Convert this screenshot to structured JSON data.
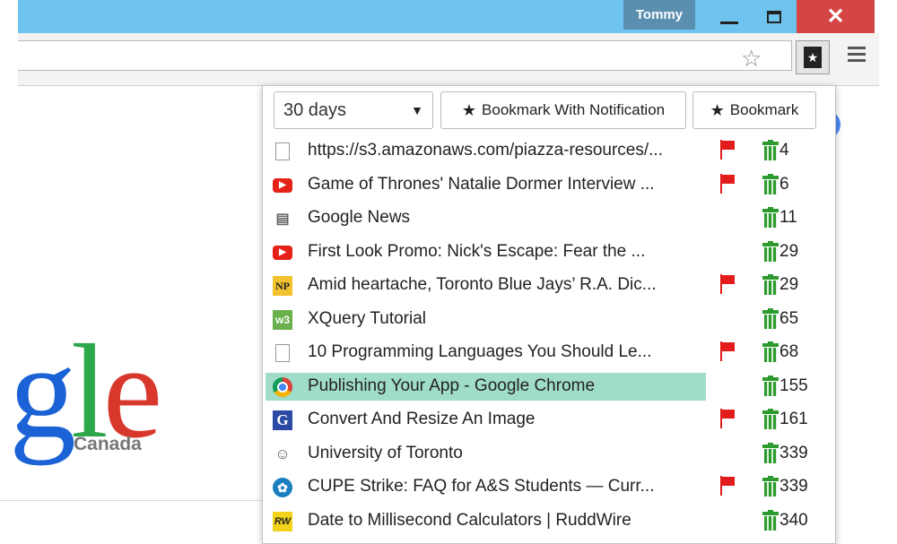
{
  "window": {
    "user": "Tommy",
    "minimize_icon": "minimize-icon",
    "maximize_icon": "maximize-icon",
    "close_label": "✕"
  },
  "toolbar": {
    "star_icon": "star-outline-icon",
    "extension_icon": "bookmark-extension-icon",
    "menu_icon": "hamburger-menu-icon"
  },
  "page": {
    "logo_letters": {
      "g": "g",
      "l": "l",
      "e": "e"
    },
    "logo_sub": "Canada"
  },
  "popup": {
    "range_select": "30 days",
    "range_arrow": "▼",
    "notify_button": "Bookmark With Notification",
    "bookmark_button": "Bookmark",
    "star_glyph": "★",
    "items": [
      {
        "icon": "doc",
        "title": "https://s3.amazonaws.com/piazza-resources/...",
        "flag": true,
        "count": "4"
      },
      {
        "icon": "yt",
        "title": "Game of Thrones' Natalie Dormer Interview ...",
        "flag": true,
        "count": "6"
      },
      {
        "icon": "news",
        "title": "Google News",
        "flag": false,
        "count": "11"
      },
      {
        "icon": "yt",
        "title": "First Look Promo: Nick's Escape: Fear the ...",
        "flag": false,
        "count": "29"
      },
      {
        "icon": "np",
        "title": "Amid heartache, Toronto Blue Jays’ R.A. Dic...",
        "flag": true,
        "count": "29"
      },
      {
        "icon": "w3",
        "title": "XQuery Tutorial",
        "flag": false,
        "count": "65"
      },
      {
        "icon": "doc",
        "title": "10 Programming Languages You Should Le...",
        "flag": true,
        "count": "68"
      },
      {
        "icon": "chrome",
        "title": "Publishing Your App - Google Chrome",
        "flag": false,
        "count": "155",
        "selected": true
      },
      {
        "icon": "g",
        "title": "Convert And Resize An Image",
        "flag": true,
        "count": "161"
      },
      {
        "icon": "reddit",
        "title": "University of Toronto",
        "flag": false,
        "count": "339"
      },
      {
        "icon": "cupe",
        "title": "CUPE Strike: FAQ for A&S Students — Curr...",
        "flag": true,
        "count": "339"
      },
      {
        "icon": "rw",
        "title": "Date to Millisecond Calculators | RuddWire",
        "flag": false,
        "count": "340"
      }
    ]
  },
  "colors": {
    "titlebar": "#6fc3ef",
    "selected_row": "#9fdcc9",
    "flag": "#e21b1b",
    "trash": "#2d9a2d"
  }
}
